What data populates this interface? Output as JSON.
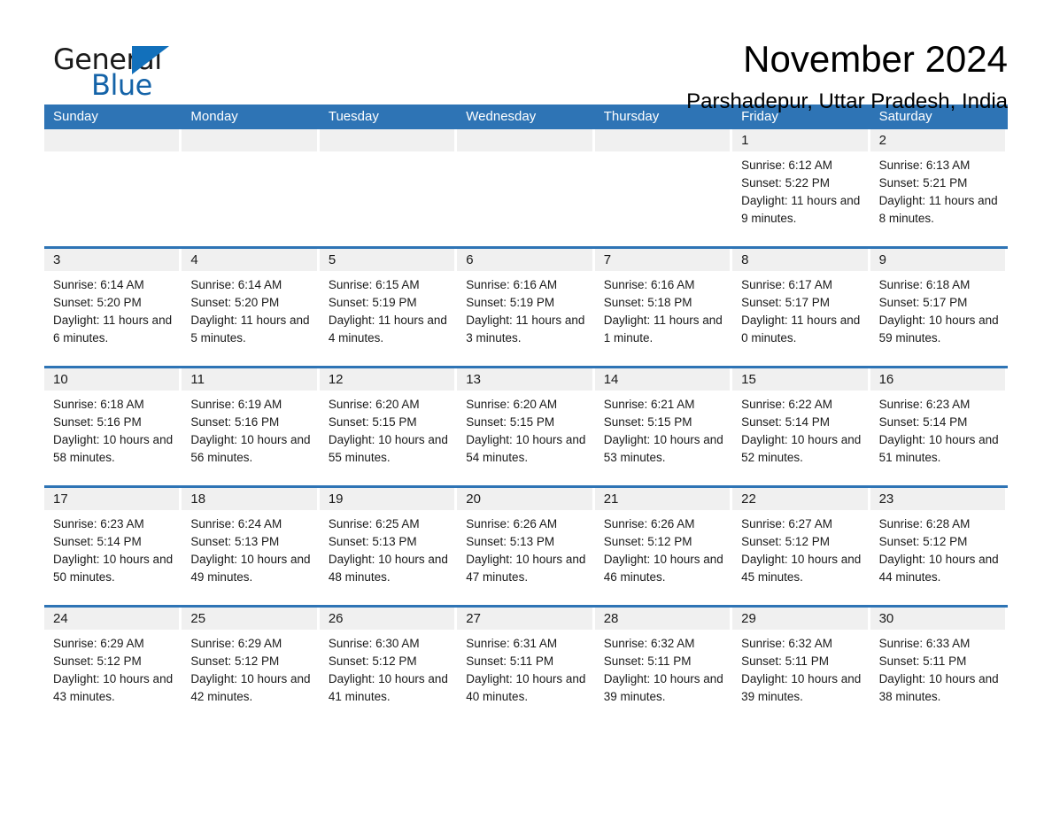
{
  "brand": {
    "word1": "General",
    "word2": "Blue",
    "flag_icon": "triangle-flag-icon",
    "accent_color": "#1270bb"
  },
  "header": {
    "month_title": "November 2024",
    "location": "Parshadepur, Uttar Pradesh, India"
  },
  "calendar": {
    "header_color": "#2e74b5",
    "datebar_color": "#f0f0f0",
    "weekdays": [
      "Sunday",
      "Monday",
      "Tuesday",
      "Wednesday",
      "Thursday",
      "Friday",
      "Saturday"
    ],
    "weeks": [
      [
        {
          "day": "",
          "empty": true
        },
        {
          "day": "",
          "empty": true
        },
        {
          "day": "",
          "empty": true
        },
        {
          "day": "",
          "empty": true
        },
        {
          "day": "",
          "empty": true
        },
        {
          "day": "1",
          "sunrise": "Sunrise: 6:12 AM",
          "sunset": "Sunset: 5:22 PM",
          "daylight": "Daylight: 11 hours and 9 minutes."
        },
        {
          "day": "2",
          "sunrise": "Sunrise: 6:13 AM",
          "sunset": "Sunset: 5:21 PM",
          "daylight": "Daylight: 11 hours and 8 minutes."
        }
      ],
      [
        {
          "day": "3",
          "sunrise": "Sunrise: 6:14 AM",
          "sunset": "Sunset: 5:20 PM",
          "daylight": "Daylight: 11 hours and 6 minutes."
        },
        {
          "day": "4",
          "sunrise": "Sunrise: 6:14 AM",
          "sunset": "Sunset: 5:20 PM",
          "daylight": "Daylight: 11 hours and 5 minutes."
        },
        {
          "day": "5",
          "sunrise": "Sunrise: 6:15 AM",
          "sunset": "Sunset: 5:19 PM",
          "daylight": "Daylight: 11 hours and 4 minutes."
        },
        {
          "day": "6",
          "sunrise": "Sunrise: 6:16 AM",
          "sunset": "Sunset: 5:19 PM",
          "daylight": "Daylight: 11 hours and 3 minutes."
        },
        {
          "day": "7",
          "sunrise": "Sunrise: 6:16 AM",
          "sunset": "Sunset: 5:18 PM",
          "daylight": "Daylight: 11 hours and 1 minute."
        },
        {
          "day": "8",
          "sunrise": "Sunrise: 6:17 AM",
          "sunset": "Sunset: 5:17 PM",
          "daylight": "Daylight: 11 hours and 0 minutes."
        },
        {
          "day": "9",
          "sunrise": "Sunrise: 6:18 AM",
          "sunset": "Sunset: 5:17 PM",
          "daylight": "Daylight: 10 hours and 59 minutes."
        }
      ],
      [
        {
          "day": "10",
          "sunrise": "Sunrise: 6:18 AM",
          "sunset": "Sunset: 5:16 PM",
          "daylight": "Daylight: 10 hours and 58 minutes."
        },
        {
          "day": "11",
          "sunrise": "Sunrise: 6:19 AM",
          "sunset": "Sunset: 5:16 PM",
          "daylight": "Daylight: 10 hours and 56 minutes."
        },
        {
          "day": "12",
          "sunrise": "Sunrise: 6:20 AM",
          "sunset": "Sunset: 5:15 PM",
          "daylight": "Daylight: 10 hours and 55 minutes."
        },
        {
          "day": "13",
          "sunrise": "Sunrise: 6:20 AM",
          "sunset": "Sunset: 5:15 PM",
          "daylight": "Daylight: 10 hours and 54 minutes."
        },
        {
          "day": "14",
          "sunrise": "Sunrise: 6:21 AM",
          "sunset": "Sunset: 5:15 PM",
          "daylight": "Daylight: 10 hours and 53 minutes."
        },
        {
          "day": "15",
          "sunrise": "Sunrise: 6:22 AM",
          "sunset": "Sunset: 5:14 PM",
          "daylight": "Daylight: 10 hours and 52 minutes."
        },
        {
          "day": "16",
          "sunrise": "Sunrise: 6:23 AM",
          "sunset": "Sunset: 5:14 PM",
          "daylight": "Daylight: 10 hours and 51 minutes."
        }
      ],
      [
        {
          "day": "17",
          "sunrise": "Sunrise: 6:23 AM",
          "sunset": "Sunset: 5:14 PM",
          "daylight": "Daylight: 10 hours and 50 minutes."
        },
        {
          "day": "18",
          "sunrise": "Sunrise: 6:24 AM",
          "sunset": "Sunset: 5:13 PM",
          "daylight": "Daylight: 10 hours and 49 minutes."
        },
        {
          "day": "19",
          "sunrise": "Sunrise: 6:25 AM",
          "sunset": "Sunset: 5:13 PM",
          "daylight": "Daylight: 10 hours and 48 minutes."
        },
        {
          "day": "20",
          "sunrise": "Sunrise: 6:26 AM",
          "sunset": "Sunset: 5:13 PM",
          "daylight": "Daylight: 10 hours and 47 minutes."
        },
        {
          "day": "21",
          "sunrise": "Sunrise: 6:26 AM",
          "sunset": "Sunset: 5:12 PM",
          "daylight": "Daylight: 10 hours and 46 minutes."
        },
        {
          "day": "22",
          "sunrise": "Sunrise: 6:27 AM",
          "sunset": "Sunset: 5:12 PM",
          "daylight": "Daylight: 10 hours and 45 minutes."
        },
        {
          "day": "23",
          "sunrise": "Sunrise: 6:28 AM",
          "sunset": "Sunset: 5:12 PM",
          "daylight": "Daylight: 10 hours and 44 minutes."
        }
      ],
      [
        {
          "day": "24",
          "sunrise": "Sunrise: 6:29 AM",
          "sunset": "Sunset: 5:12 PM",
          "daylight": "Daylight: 10 hours and 43 minutes."
        },
        {
          "day": "25",
          "sunrise": "Sunrise: 6:29 AM",
          "sunset": "Sunset: 5:12 PM",
          "daylight": "Daylight: 10 hours and 42 minutes."
        },
        {
          "day": "26",
          "sunrise": "Sunrise: 6:30 AM",
          "sunset": "Sunset: 5:12 PM",
          "daylight": "Daylight: 10 hours and 41 minutes."
        },
        {
          "day": "27",
          "sunrise": "Sunrise: 6:31 AM",
          "sunset": "Sunset: 5:11 PM",
          "daylight": "Daylight: 10 hours and 40 minutes."
        },
        {
          "day": "28",
          "sunrise": "Sunrise: 6:32 AM",
          "sunset": "Sunset: 5:11 PM",
          "daylight": "Daylight: 10 hours and 39 minutes."
        },
        {
          "day": "29",
          "sunrise": "Sunrise: 6:32 AM",
          "sunset": "Sunset: 5:11 PM",
          "daylight": "Daylight: 10 hours and 39 minutes."
        },
        {
          "day": "30",
          "sunrise": "Sunrise: 6:33 AM",
          "sunset": "Sunset: 5:11 PM",
          "daylight": "Daylight: 10 hours and 38 minutes."
        }
      ]
    ]
  }
}
